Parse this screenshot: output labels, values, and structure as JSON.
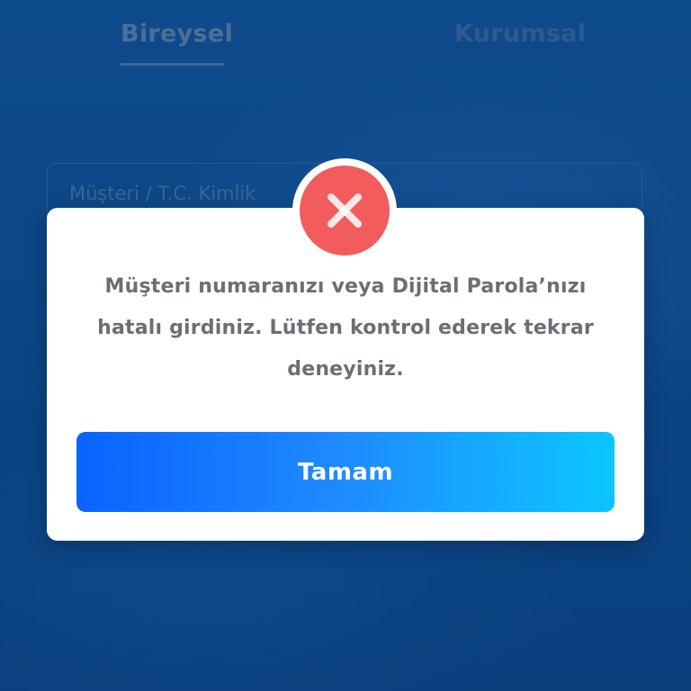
{
  "background": {
    "tabs": [
      {
        "label": "Bireysel",
        "active": true
      },
      {
        "label": "Kurumsal",
        "active": false
      }
    ],
    "customer_input": {
      "placeholder": "Müşteri / T.C. Kimlik"
    }
  },
  "dialog": {
    "icon": "error-x-icon",
    "message": "Müşteri numaranızı veya Dijital Parola’nızı hatalı girdiniz. Lütfen kontrol ederek tekrar deneyiniz.",
    "ok_label": "Tamam"
  },
  "colors": {
    "background": "#0c4a8a",
    "error": "#f25c5c",
    "button_gradient_start": "#0a63ff",
    "button_gradient_end": "#0cc6ff",
    "message_text": "#6b6f75"
  }
}
